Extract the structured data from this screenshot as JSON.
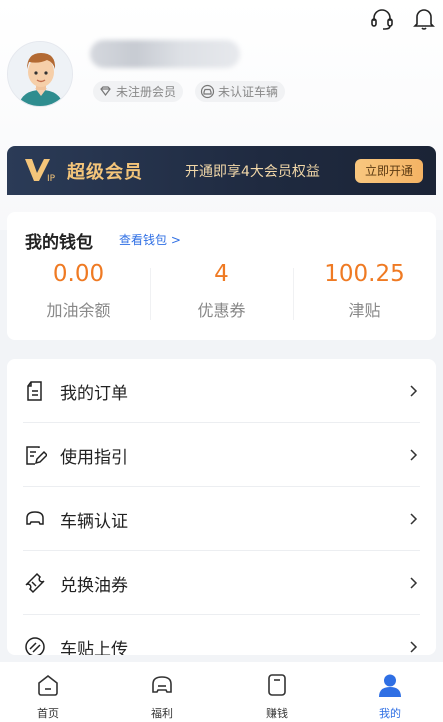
{
  "header": {
    "username": "",
    "tags": [
      {
        "icon": "diamond-icon",
        "label": "未注册会员"
      },
      {
        "icon": "car-icon",
        "label": "未认证车辆"
      }
    ]
  },
  "vip": {
    "title": "超级会员",
    "desc": "开通即享4大会员权益",
    "button": "立即开通"
  },
  "wallet": {
    "title": "我的钱包",
    "link": "查看钱包 >",
    "items": [
      {
        "value": "0.00",
        "label": "加油余额"
      },
      {
        "value": "4",
        "label": "优惠券"
      },
      {
        "value": "100.25",
        "label": "津贴"
      }
    ]
  },
  "menu": [
    {
      "icon": "orders-icon",
      "label": "我的订单"
    },
    {
      "icon": "guide-icon",
      "label": "使用指引"
    },
    {
      "icon": "vehicle-icon",
      "label": "车辆认证"
    },
    {
      "icon": "coupon-icon",
      "label": "兑换油券"
    },
    {
      "icon": "sticker-icon",
      "label": "车贴上传"
    }
  ],
  "tabbar": [
    {
      "icon": "home-icon",
      "label": "首页"
    },
    {
      "icon": "welfare-icon",
      "label": "福利"
    },
    {
      "icon": "earn-icon",
      "label": "赚钱"
    },
    {
      "icon": "profile-icon",
      "label": "我的",
      "active": true
    }
  ],
  "colors": {
    "accent": "#2f6fe4",
    "orange": "#ef7a23",
    "vip_gold": "#f4c57a"
  }
}
